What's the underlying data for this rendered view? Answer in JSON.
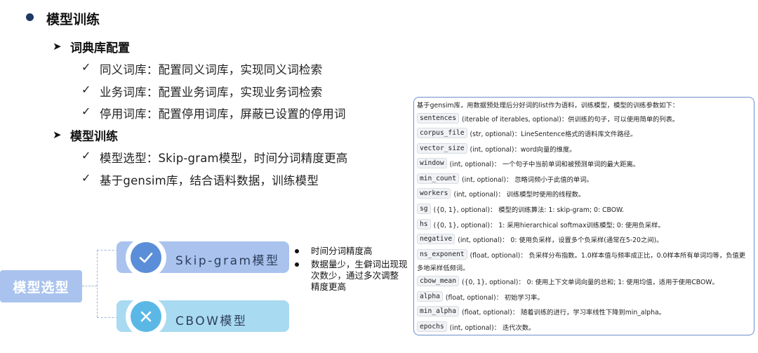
{
  "outline": {
    "title": "模型训练",
    "sections": [
      {
        "heading": "词典库配置",
        "items": [
          "同义词库：配置同义词库，实现同义词检索",
          "业务词库：配置业务词库，实现业务词检索",
          "停用词库：配置停用词库，屏蔽已设置的停用词"
        ]
      },
      {
        "heading": "模型训练",
        "items": [
          "模型选型：Skip-gram模型，时间分词精度更高",
          "基于gensim库，结合语料数据，训练模型"
        ]
      }
    ]
  },
  "diagram": {
    "root": "模型选型",
    "models": [
      {
        "label": "Skip-gram模型",
        "icon": "check-icon",
        "color": "#5b8ed8"
      },
      {
        "label": "CBOW模型",
        "icon": "cross-icon",
        "color": "#5bb8e6"
      }
    ],
    "notes": [
      "时间分词精度高",
      "数据量少，生僻词出现次数少，通过多次调整精度更高"
    ],
    "note_lines": [
      "数据量少，生僻词出现现",
      "次数少，通过多次调整",
      "精度更高"
    ]
  },
  "params": {
    "intro": "基于gensim库，用数据预处理后分好词的list作为语料，训练模型，模型的训练参数如下：",
    "rows": [
      {
        "name": "sentences",
        "desc": "(iterable of iterables, optional)：供训练的句子，可以使用简单的列表。"
      },
      {
        "name": "corpus_file",
        "desc": "(str, optional)：LineSentence格式的语料库文件路径。"
      },
      {
        "name": "vector_size",
        "desc": "(int, optional)：word向量的维度。"
      },
      {
        "name": "window",
        "desc": "(int, optional)：  一个句子中当前单词和被预测单词的最大距离。"
      },
      {
        "name": "min_count",
        "desc": "(int, optional)：  忽略词频小于此值的单词。"
      },
      {
        "name": "workers",
        "desc": "(int, optional)：  训练模型时使用的线程数。"
      },
      {
        "name": "sg",
        "desc": "({0, 1}, optional)：  模型的训练算法: 1: skip-gram; 0: CBOW."
      },
      {
        "name": "hs",
        "desc": "({0, 1}, optional)：  1: 采用hierarchical softmax训练模型; 0: 使用负采样。"
      },
      {
        "name": "negative",
        "desc": "(int, optional)：  0: 使用负采样，设置多个负采样(通常在5-20之间)。"
      },
      {
        "name": "ns_exponent",
        "desc": "(float, optional)：  负采样分布指数。1.0样本值与频率成正比，0.0样本所有单词均等，负值更",
        "desc2": "多地采样低频词。"
      },
      {
        "name": "cbow_mean",
        "desc": "({0, 1}, optional)：  0: 使用上下文单词向量的总和; 1: 使用均值，适用于使用CBOW。"
      },
      {
        "name": "alpha",
        "desc": "(float, optional)：  初始学习率。"
      },
      {
        "name": "min_alpha",
        "desc": "(float, optional)：  随着训练的进行，学习率线性下降到min_alpha。"
      },
      {
        "name": "epochs",
        "desc": "(int, optional)：  迭代次数。"
      }
    ]
  }
}
